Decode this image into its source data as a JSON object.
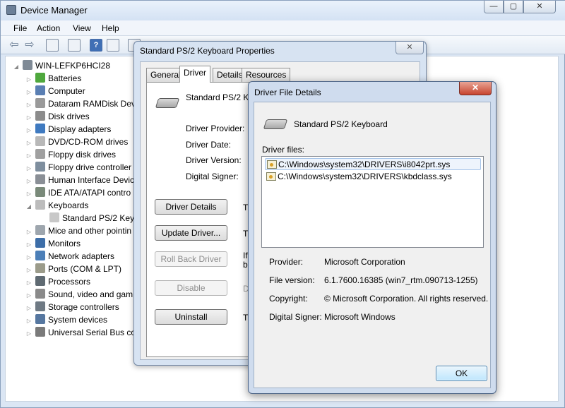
{
  "window": {
    "title": "Device Manager"
  },
  "window_controls": {
    "minimize": "—",
    "maximize": "▢",
    "close": "✕"
  },
  "menu": [
    "File",
    "Action",
    "View",
    "Help"
  ],
  "tree": {
    "root": "WIN-LEFKP6HCI28",
    "items": [
      "Batteries",
      "Computer",
      "Dataram RAMDisk Dev",
      "Disk drives",
      "Display adapters",
      "DVD/CD-ROM drives",
      "Floppy disk drives",
      "Floppy drive controller",
      "Human Interface Devic",
      "IDE ATA/ATAPI contro",
      "Keyboards",
      "Standard PS/2 Keyb",
      "Mice and other pointin",
      "Monitors",
      "Network adapters",
      "Ports (COM & LPT)",
      "Processors",
      "Sound, video and gam",
      "Storage controllers",
      "System devices",
      "Universal Serial Bus co"
    ]
  },
  "properties": {
    "title": "Standard PS/2 Keyboard Properties",
    "close_glyph": "✕",
    "tabs": [
      "General",
      "Driver",
      "Details",
      "Resources"
    ],
    "device_name": "Standard PS/2 Ke",
    "fields": [
      "Driver Provider:",
      "Driver Date:",
      "Driver Version:",
      "Digital Signer:"
    ],
    "buttons": [
      "Driver Details",
      "Update Driver...",
      "Roll Back Driver",
      "Disable",
      "Uninstall"
    ],
    "side_letters": [
      "T",
      "T",
      "If",
      "b",
      "D",
      "T"
    ]
  },
  "file_details": {
    "title": "Driver File Details",
    "close_glyph": "✕",
    "device_name": "Standard PS/2 Keyboard",
    "files_label": "Driver files:",
    "files": [
      "C:\\Windows\\system32\\DRIVERS\\i8042prt.sys",
      "C:\\Windows\\system32\\DRIVERS\\kbdclass.sys"
    ],
    "info": [
      {
        "label": "Provider:",
        "value": "Microsoft Corporation"
      },
      {
        "label": "File version:",
        "value": "6.1.7600.16385 (win7_rtm.090713-1255)"
      },
      {
        "label": "Copyright:",
        "value": "© Microsoft Corporation. All rights reserved."
      },
      {
        "label": "Digital Signer:",
        "value": "Microsoft Windows"
      }
    ],
    "ok_label": "OK"
  }
}
